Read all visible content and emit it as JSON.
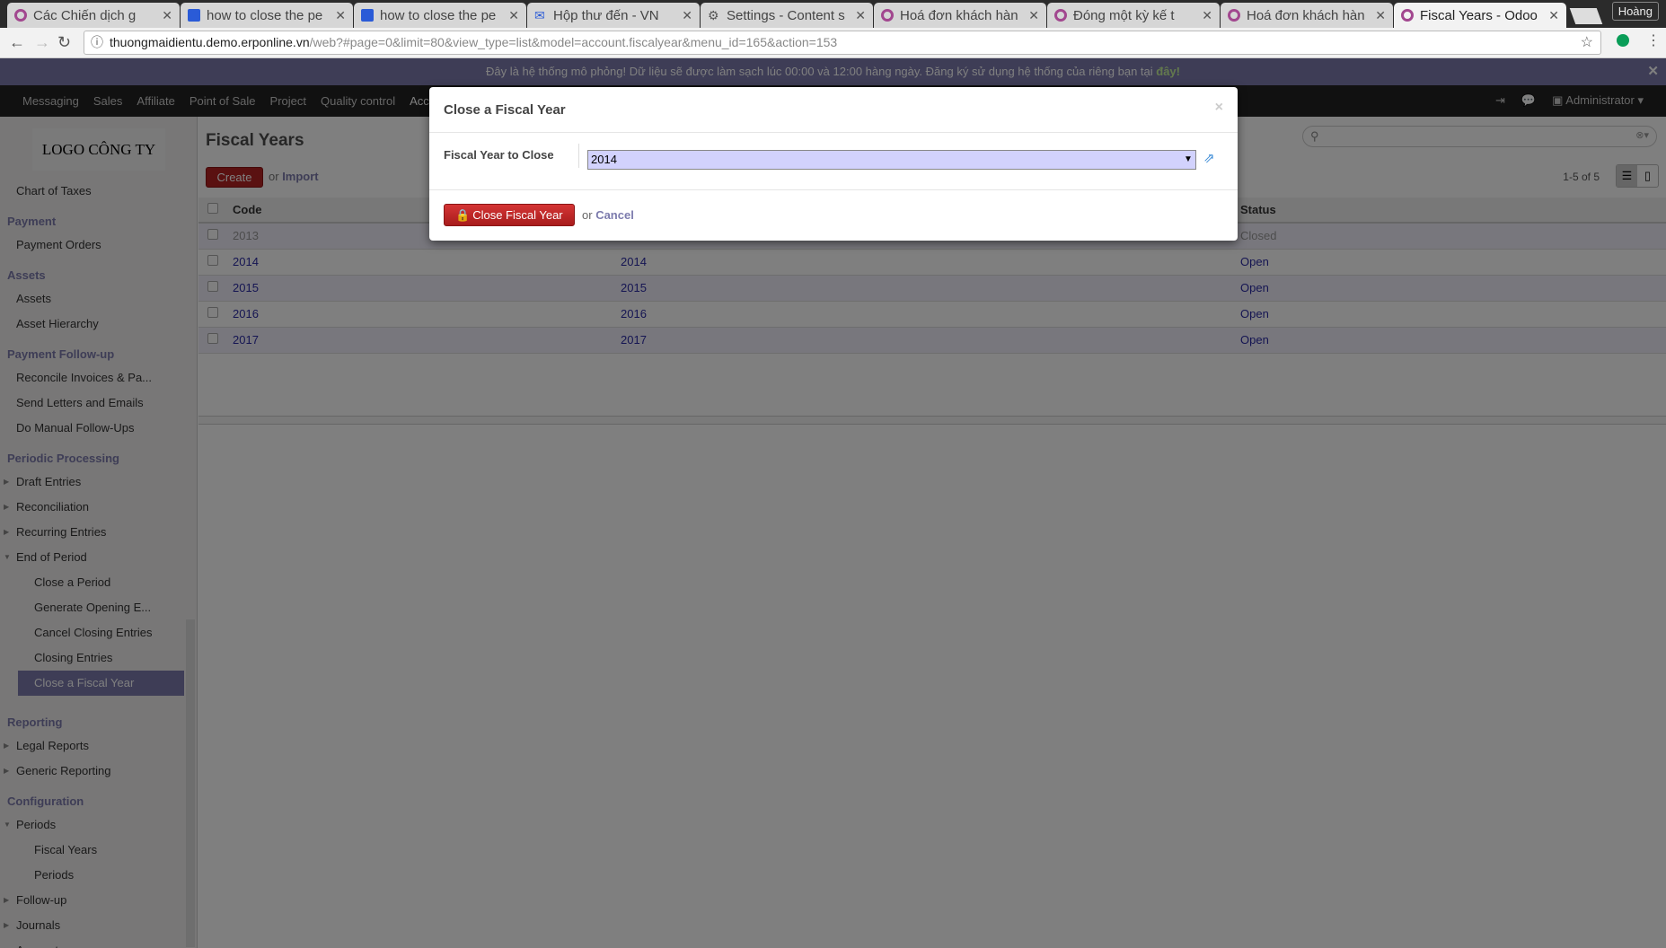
{
  "browser": {
    "tabs": [
      {
        "title": "Các Chiến dịch g",
        "icon": "odoo-icon"
      },
      {
        "title": "how to close the pe",
        "icon": "forum-icon"
      },
      {
        "title": "how to close the pe",
        "icon": "forum-icon"
      },
      {
        "title": "Hộp thư đến - VN",
        "icon": "mail-icon"
      },
      {
        "title": "Settings - Content s",
        "icon": "gear-icon"
      },
      {
        "title": "Hoá đơn khách hàn",
        "icon": "odoo-icon"
      },
      {
        "title": "Đóng một kỳ kế t",
        "icon": "odoo-icon"
      },
      {
        "title": "Hoá đơn khách hàn",
        "icon": "odoo-icon"
      },
      {
        "title": "Fiscal Years - Odoo",
        "icon": "odoo-icon",
        "active": true
      }
    ],
    "user": "Hoàng",
    "url_host": "thuongmaidientu.demo.erponline.vn",
    "url_path": "/web?#page=0&limit=80&view_type=list&model=account.fiscalyear&menu_id=165&action=153",
    "extension_badge": "1"
  },
  "banner": {
    "text": "Đây là hệ thống mô phỏng! Dữ liệu sẽ được làm sạch lúc 00:00 và 12:00 hàng ngày. Đăng ký sử dụng hệ thống của riêng bạn tại ",
    "link": "đây!"
  },
  "topmenu": {
    "items": [
      "Messaging",
      "Sales",
      "Affiliate",
      "Point of Sale",
      "Project",
      "Quality control",
      "Acc"
    ],
    "user": "Administrator"
  },
  "sidebar": {
    "logo": "LOGO CÔNG TY",
    "items": [
      {
        "label": "Chart of Taxes",
        "type": "item"
      },
      {
        "label": "Payment",
        "type": "header"
      },
      {
        "label": "Payment Orders",
        "type": "item"
      },
      {
        "label": "Assets",
        "type": "header"
      },
      {
        "label": "Assets",
        "type": "item"
      },
      {
        "label": "Asset Hierarchy",
        "type": "item"
      },
      {
        "label": "Payment Follow-up",
        "type": "header"
      },
      {
        "label": "Reconcile Invoices & Pa...",
        "type": "item"
      },
      {
        "label": "Send Letters and Emails",
        "type": "item"
      },
      {
        "label": "Do Manual Follow-Ups",
        "type": "item"
      },
      {
        "label": "Periodic Processing",
        "type": "header"
      },
      {
        "label": "Draft Entries",
        "type": "collapsed"
      },
      {
        "label": "Reconciliation",
        "type": "collapsed"
      },
      {
        "label": "Recurring Entries",
        "type": "collapsed"
      },
      {
        "label": "End of Period",
        "type": "expanded"
      },
      {
        "label": "Close a Period",
        "type": "sub"
      },
      {
        "label": "Generate Opening E...",
        "type": "sub"
      },
      {
        "label": "Cancel Closing Entries",
        "type": "sub"
      },
      {
        "label": "Closing Entries",
        "type": "sub"
      },
      {
        "label": "Close a Fiscal Year",
        "type": "selected"
      },
      {
        "label": "Reporting",
        "type": "header"
      },
      {
        "label": "Legal Reports",
        "type": "collapsed"
      },
      {
        "label": "Generic Reporting",
        "type": "collapsed"
      },
      {
        "label": "Configuration",
        "type": "header"
      },
      {
        "label": "Periods",
        "type": "expanded"
      },
      {
        "label": "Fiscal Years",
        "type": "sub"
      },
      {
        "label": "Periods",
        "type": "sub"
      },
      {
        "label": "Follow-up",
        "type": "collapsed"
      },
      {
        "label": "Journals",
        "type": "collapsed"
      },
      {
        "label": "Accounts",
        "type": "collapsed"
      }
    ]
  },
  "main": {
    "title": "Fiscal Years",
    "create": "Create",
    "or": "or",
    "import": "Import",
    "pager": "1-5 of 5",
    "columns": [
      "Code",
      "Status"
    ],
    "rows": [
      {
        "code": "2013",
        "name": "",
        "status": "Closed"
      },
      {
        "code": "2014",
        "name": "2014",
        "status": "Open"
      },
      {
        "code": "2015",
        "name": "2015",
        "status": "Open"
      },
      {
        "code": "2016",
        "name": "2016",
        "status": "Open"
      },
      {
        "code": "2017",
        "name": "2017",
        "status": "Open"
      }
    ]
  },
  "dialog": {
    "title": "Close a Fiscal Year",
    "field_label": "Fiscal Year to Close",
    "field_value": "2014",
    "confirm": "Close Fiscal Year",
    "or": "or",
    "cancel": "Cancel"
  },
  "colors": {
    "accent": "#7c7bad",
    "danger": "#b52222",
    "link": "#2a2aa5"
  }
}
